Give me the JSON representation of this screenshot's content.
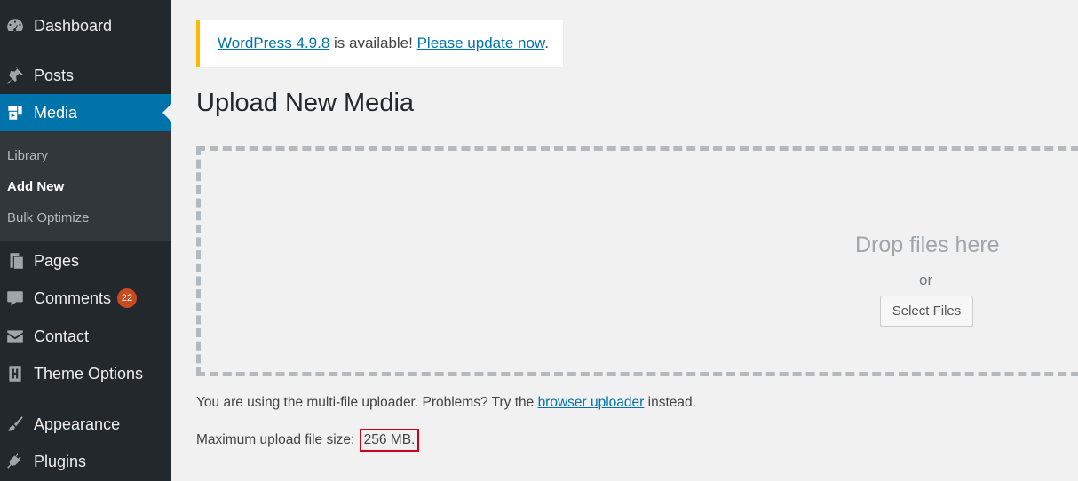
{
  "sidebar": {
    "items": [
      {
        "label": "Dashboard",
        "icon": "dashboard-icon"
      },
      {
        "label": "Posts",
        "icon": "pin-icon"
      },
      {
        "label": "Media",
        "icon": "media-icon",
        "active": true
      },
      {
        "label": "Pages",
        "icon": "pages-icon"
      },
      {
        "label": "Comments",
        "icon": "comment-icon",
        "badge": "22"
      },
      {
        "label": "Contact",
        "icon": "envelope-icon"
      },
      {
        "label": "Theme Options",
        "icon": "theme-options-icon"
      },
      {
        "label": "Appearance",
        "icon": "paintbrush-icon"
      },
      {
        "label": "Plugins",
        "icon": "plug-icon"
      }
    ],
    "submenu": [
      {
        "label": "Library"
      },
      {
        "label": "Add New",
        "current": true
      },
      {
        "label": "Bulk Optimize"
      }
    ]
  },
  "notice": {
    "version_link": "WordPress 4.9.8",
    "middle_text": " is available! ",
    "update_link": "Please update now",
    "end_text": "."
  },
  "main": {
    "title": "Upload New Media",
    "drop_text": "Drop files here",
    "or_text": "or",
    "select_button": "Select Files",
    "uploader_text_1": "You are using the multi-file uploader. Problems? Try the ",
    "uploader_link": "browser uploader",
    "uploader_text_2": " instead.",
    "max_size_label": "Maximum upload file size: ",
    "max_size_value": "256 MB."
  },
  "colors": {
    "sidebar_bg": "#23282d",
    "active_bg": "#0073aa",
    "notice_border": "#ffb900",
    "highlight_border": "#d0021b",
    "badge_bg": "#ca4a1f"
  }
}
